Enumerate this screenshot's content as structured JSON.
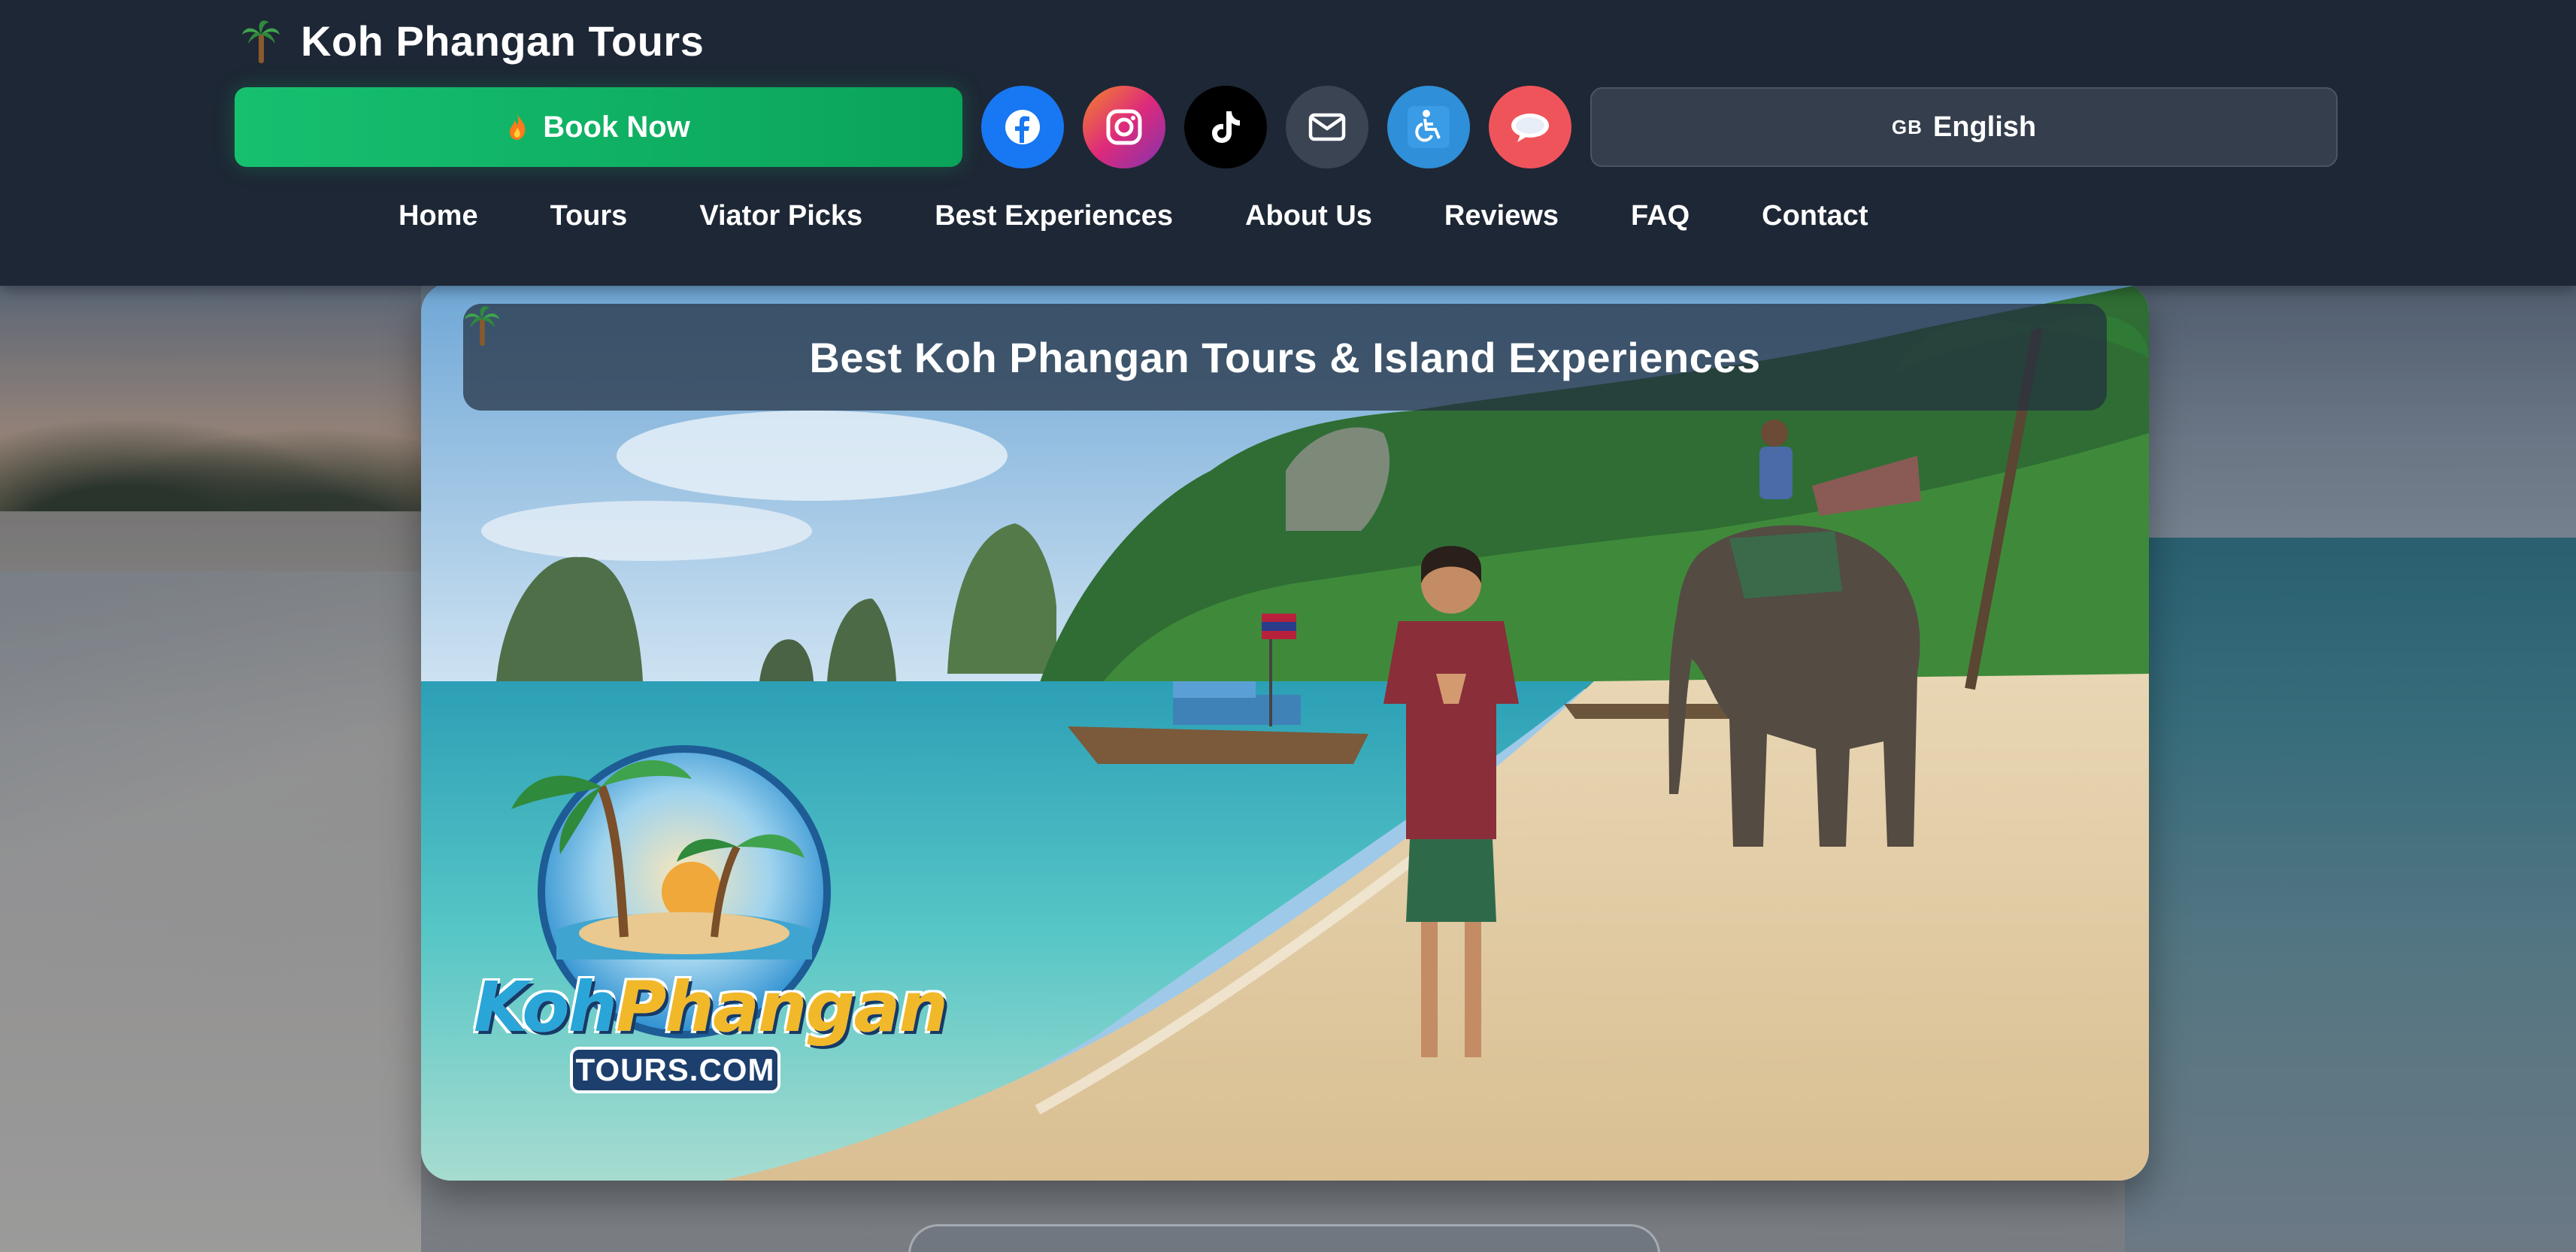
{
  "header": {
    "brand_title": "Koh Phangan Tours",
    "book_now_label": "Book Now",
    "social": [
      {
        "name": "facebook",
        "icon": "facebook-icon",
        "color": "#1877f2"
      },
      {
        "name": "instagram",
        "icon": "instagram-icon",
        "color": "#dd2a7b"
      },
      {
        "name": "tiktok",
        "icon": "tiktok-icon",
        "color": "#000000"
      },
      {
        "name": "email",
        "icon": "mail-icon",
        "color": "#3a4452"
      },
      {
        "name": "accessibility",
        "icon": "wheelchair-icon",
        "color": "#2f8fd8"
      },
      {
        "name": "chat",
        "icon": "chat-bubble-icon",
        "color": "#f0545b"
      }
    ],
    "language": {
      "flag": "GB",
      "label": "English"
    }
  },
  "nav": {
    "items": [
      "Home",
      "Tours",
      "Viator Picks",
      "Best Experiences",
      "About Us",
      "Reviews",
      "FAQ",
      "Contact"
    ]
  },
  "hero": {
    "title": "Best Koh Phangan Tours & Island Experiences",
    "logo": {
      "word1a": "Koh",
      "word1b": "Phangan",
      "word2": "TOURS.COM"
    }
  },
  "peek_text": "",
  "colors": {
    "header_bg": "#1e2735",
    "book_now": "#0aa35a",
    "lang_button": "#343e4c"
  }
}
